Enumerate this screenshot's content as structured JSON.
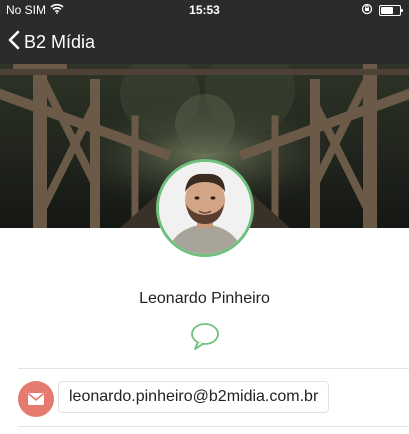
{
  "status_bar": {
    "carrier": "No SIM",
    "time": "15:53",
    "icons": [
      "wifi-icon",
      "orientation-lock-icon",
      "battery-icon"
    ]
  },
  "nav": {
    "back_label": "B2 Mídia",
    "back_icon": "chevron-left-icon",
    "background": "#2b2b2b"
  },
  "profile": {
    "name": "Leonardo Pinheiro",
    "avatar_border_color": "#6fbf7d",
    "chat_icon": "chat-bubble-icon",
    "chat_icon_color": "#6fbf7d"
  },
  "contact": {
    "email_icon": "envelope-icon",
    "email_icon_color": "#e57a6f",
    "email": "leonardo.pinheiro@b2midia.com.br"
  }
}
